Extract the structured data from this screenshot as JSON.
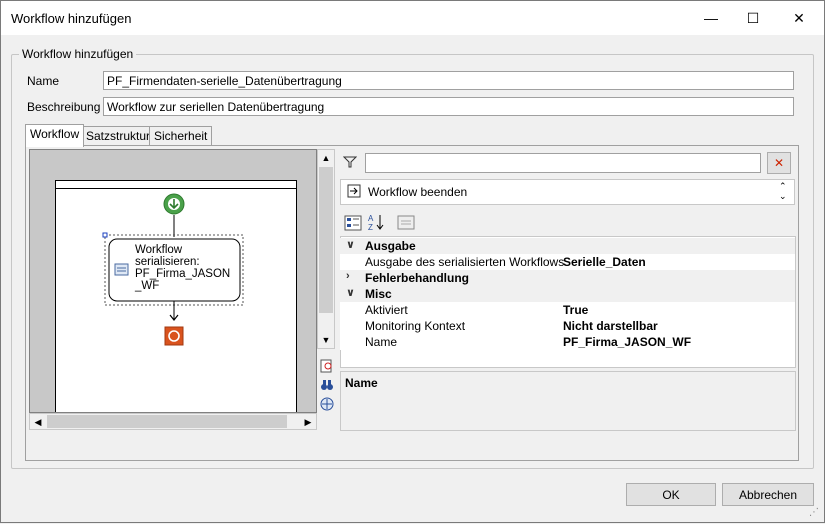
{
  "window": {
    "title": "Workflow hinzufügen",
    "minimize_glyph": "—",
    "maximize_glyph": "☐",
    "close_glyph": "✕"
  },
  "group": {
    "legend": "Workflow hinzufügen"
  },
  "form": {
    "name_label": "Name",
    "name_value": "PF_Firmendaten-serielle_Datenübertragung",
    "description_label": "Beschreibung",
    "description_value": "Workflow zur seriellen Datenübertragung"
  },
  "tabs": [
    {
      "label": "Workflow"
    },
    {
      "label": "Satzstruktur"
    },
    {
      "label": "Sicherheit"
    }
  ],
  "designer": {
    "activity_text": [
      "Workflow",
      "serialisieren:",
      "PF_Firma_JASON",
      "_WF"
    ]
  },
  "properties": {
    "filter_value": "",
    "selected_object": "Workflow beenden",
    "categories": {
      "ausgabe": "Ausgabe",
      "fehler": "Fehlerbehandlung",
      "misc": "Misc"
    },
    "rows": {
      "ausgabe_name": "Ausgabe des serialisierten Workflows",
      "ausgabe_value": "Serielle_Daten",
      "aktiviert_name": "Aktiviert",
      "aktiviert_value": "True",
      "monitoring_name": "Monitoring Kontext",
      "monitoring_value": "Nicht darstellbar",
      "name_name": "Name",
      "name_value": "PF_Firma_JASON_WF"
    },
    "description_title": "Name"
  },
  "buttons": {
    "ok": "OK",
    "cancel": "Abbrechen"
  },
  "colors": {
    "start_green": "#4aa14a",
    "end_red": "#d9531e",
    "close_red": "#cc2200"
  }
}
